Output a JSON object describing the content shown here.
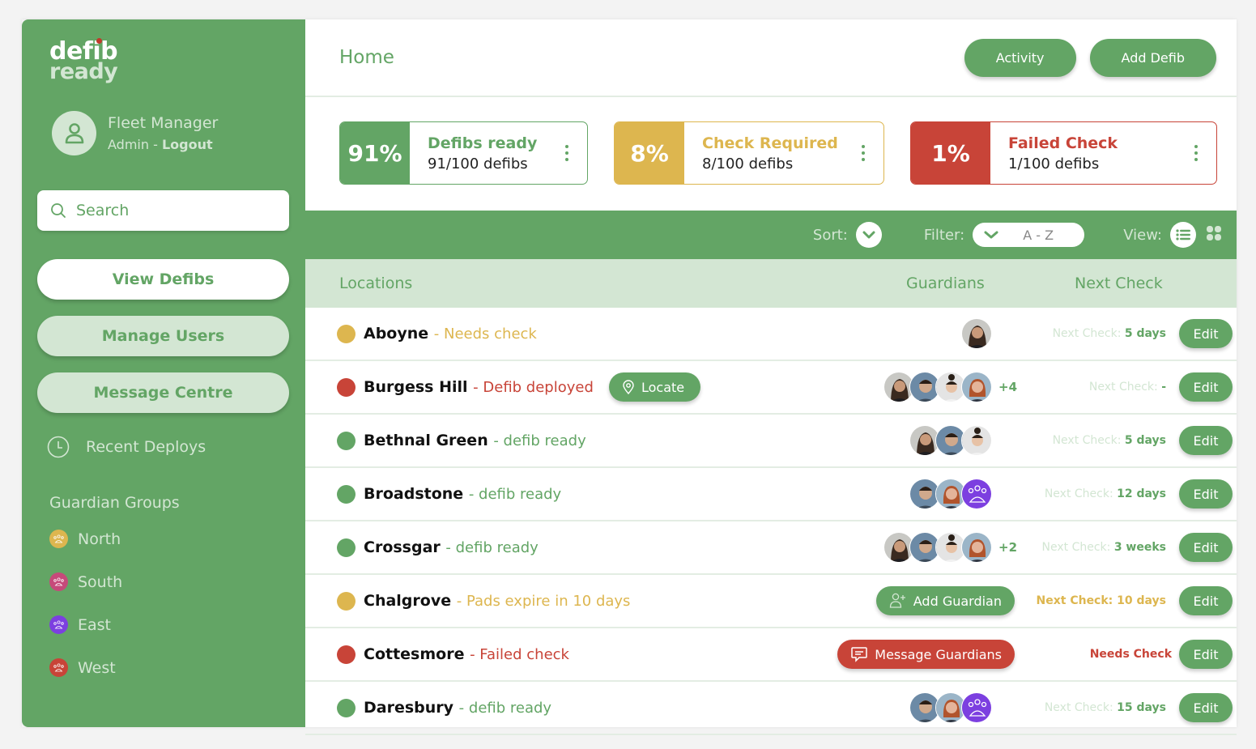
{
  "brand": {
    "line1": "defib",
    "line2": "ready"
  },
  "profile": {
    "name": "Fleet Manager",
    "role": "Admin",
    "separator": " - ",
    "logout": "Logout"
  },
  "search": {
    "placeholder": "Search",
    "value": ""
  },
  "nav": {
    "view_defibs": "View Defibs",
    "manage_users": "Manage Users",
    "message_centre": "Message Centre",
    "recent_deploys": "Recent Deploys"
  },
  "guardian_groups": {
    "title": "Guardian Groups",
    "items": [
      {
        "label": "North",
        "color": "#ddb64f"
      },
      {
        "label": "South",
        "color": "#c64a7a"
      },
      {
        "label": "East",
        "color": "#7c3fe0"
      },
      {
        "label": "West",
        "color": "#c84438"
      }
    ]
  },
  "header": {
    "title": "Home",
    "activity": "Activity",
    "add_defib": "Add Defib"
  },
  "stats": [
    {
      "pct": "91%",
      "label": "Defibs ready",
      "count": "91/100 defibs",
      "color": "#63a565"
    },
    {
      "pct": "8%",
      "label": "Check Required",
      "count": "8/100 defibs",
      "color": "#ddb64f"
    },
    {
      "pct": "1%",
      "label": "Failed Check",
      "count": "1/100 defibs",
      "color": "#c84438"
    }
  ],
  "toolbar": {
    "sort": "Sort:",
    "filter": "Filter:",
    "filter_value": "A - Z",
    "view": "View:"
  },
  "table": {
    "headers": {
      "locations": "Locations",
      "guardians": "Guardians",
      "next_check": "Next Check"
    },
    "edit_label": "Edit",
    "next_check_label": "Next Check: ",
    "rows": [
      {
        "name": "Aboyne",
        "status": "- Needs check",
        "status_color": "#ddb64f",
        "next_check": "5 days",
        "extra": ""
      },
      {
        "name": "Burgess Hill",
        "status": "- Defib deployed",
        "status_color": "#c84438",
        "next_check": "-",
        "extra": "+4",
        "action": "Locate"
      },
      {
        "name": "Bethnal Green",
        "status": "- defib ready",
        "status_color": "#63a565",
        "next_check": "5 days",
        "extra": ""
      },
      {
        "name": "Broadstone",
        "status": "- defib ready",
        "status_color": "#63a565",
        "next_check": "12 days",
        "extra": ""
      },
      {
        "name": "Crossgar",
        "status": "- defib ready",
        "status_color": "#63a565",
        "next_check": "3 weeks",
        "extra": "+2"
      },
      {
        "name": "Chalgrove",
        "status": "- Pads expire in 10 days",
        "status_color": "#ddb64f",
        "next_check": "Next Check: 10 days",
        "action": "Add Guardian"
      },
      {
        "name": "Cottesmore",
        "status": "- Failed check",
        "status_color": "#c84438",
        "next_check": "Needs Check",
        "action": "Message Guardians"
      },
      {
        "name": "Daresbury",
        "status": "- defib ready",
        "status_color": "#63a565",
        "next_check": "15 days",
        "extra": ""
      }
    ]
  }
}
